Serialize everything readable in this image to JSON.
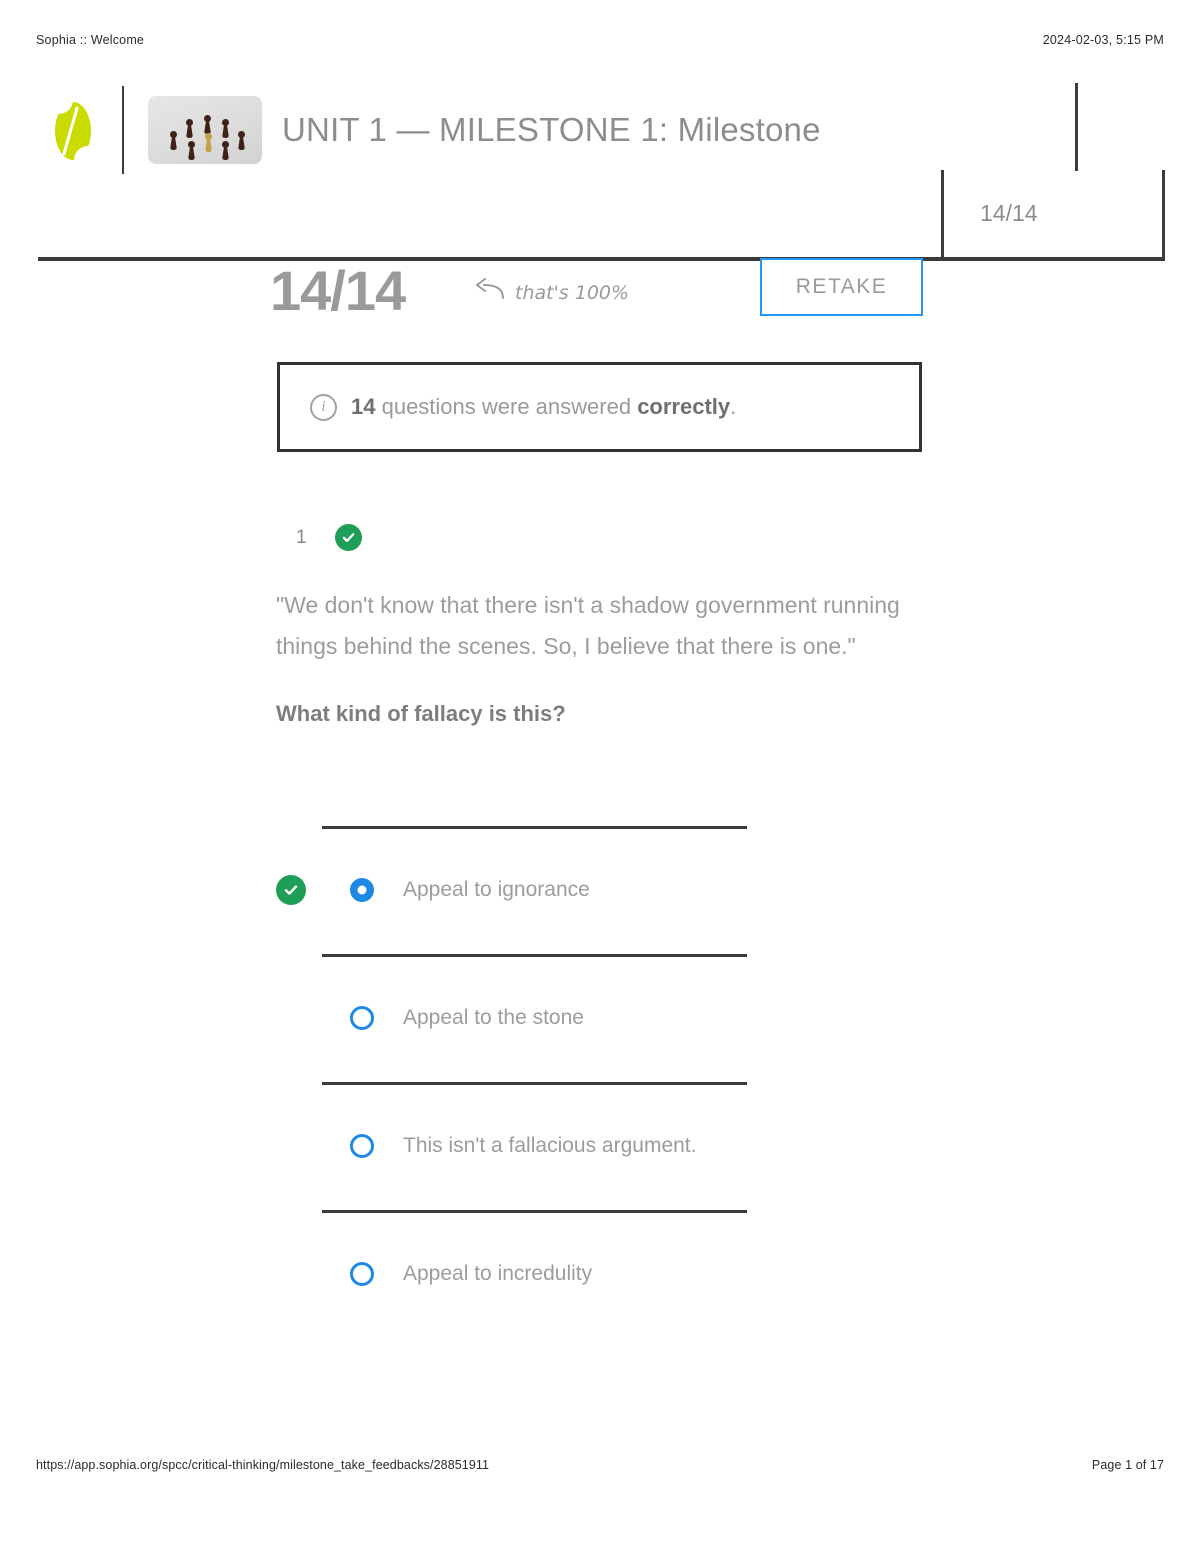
{
  "print_header": {
    "left": "Sophia :: Welcome",
    "right": "2024-02-03, 5:15 PM"
  },
  "print_footer": {
    "url": "https://app.sophia.org/spcc/critical-thinking/milestone_take_feedbacks/28851911",
    "page": "Page 1 of 17"
  },
  "header": {
    "logo_name": "sophia-logo",
    "course_thumb_name": "chess-pawns-thumbnail",
    "title": "UNIT 1 — MILESTONE 1: Milestone",
    "score_badge": "14/14"
  },
  "score_row": {
    "score": "14/14",
    "note": "that's 100%",
    "retake_label": "RETAKE"
  },
  "info_banner": {
    "count": "14",
    "text_mid": " questions were answered ",
    "emphasis": "correctly",
    "period": "."
  },
  "question": {
    "number": "1",
    "quote": "\"We don't know that there isn't a shadow government running things behind the scenes. So, I believe that there is one.\"",
    "prompt": "What kind of fallacy is this?",
    "options": [
      {
        "label": "Appeal to ignorance",
        "selected": true,
        "correct": true
      },
      {
        "label": "Appeal to the stone",
        "selected": false,
        "correct": false
      },
      {
        "label": "This isn't a fallacious argument.",
        "selected": false,
        "correct": false
      },
      {
        "label": "Appeal to incredulity",
        "selected": false,
        "correct": false
      }
    ]
  },
  "colors": {
    "brand_green": "#c9db00",
    "correct_green": "#1e9e57",
    "accent_blue": "#1e88e5",
    "retake_border": "#2196f3",
    "rule_dark": "#3b3b3b",
    "text_gray": "#9c9c9c"
  }
}
